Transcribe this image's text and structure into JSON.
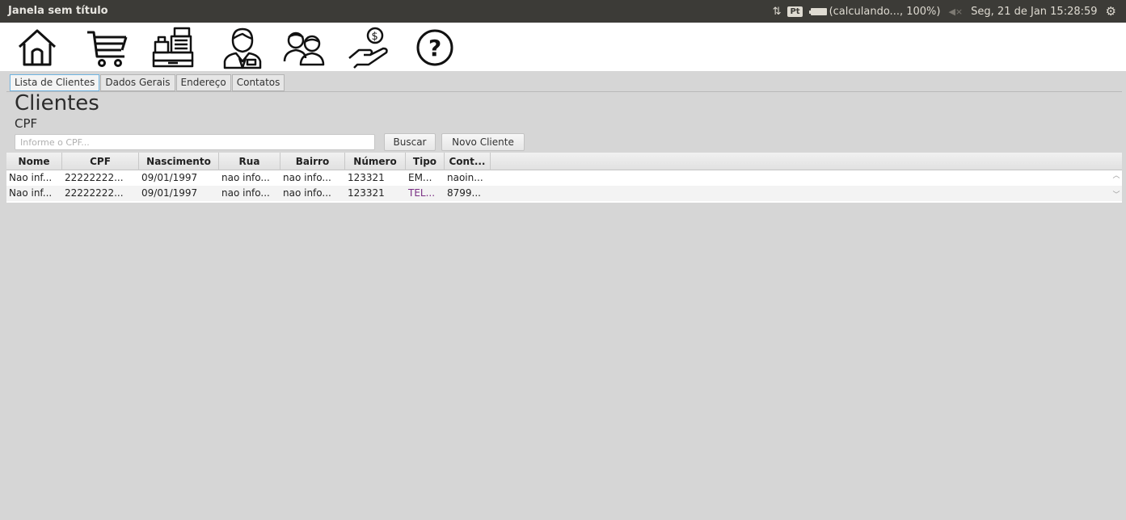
{
  "window": {
    "title": "Janela sem título"
  },
  "system": {
    "lang": "Pt",
    "battery": "(calculando..., 100%)",
    "datetime": "Seg, 21 de Jan 15:28:59"
  },
  "toolbar": {
    "icons": [
      "home-icon",
      "cart-icon",
      "cash-register-icon",
      "user-icon",
      "users-icon",
      "payment-hand-icon",
      "help-icon"
    ]
  },
  "tabs": [
    {
      "label": "Lista de Clientes",
      "active": true
    },
    {
      "label": "Dados Gerais",
      "active": false
    },
    {
      "label": "Endereço",
      "active": false
    },
    {
      "label": "Contatos",
      "active": false
    }
  ],
  "page": {
    "title": "Clientes",
    "cpf_label": "CPF",
    "cpf_placeholder": "Informe o CPF...",
    "buscar_label": "Buscar",
    "novo_label": "Novo Cliente"
  },
  "table": {
    "columns": [
      "Nome",
      "CPF",
      "Nascimento",
      "Rua",
      "Bairro",
      "Número",
      "Tipo",
      "Cont..."
    ],
    "rows": [
      [
        "Nao inf...",
        "22222222...",
        "09/01/1997",
        "nao info...",
        "nao info...",
        "123321",
        "EM...",
        "naoin..."
      ],
      [
        "Nao inf...",
        "22222222...",
        "09/01/1997",
        "nao info...",
        "nao info...",
        "123321",
        "TEL...",
        "8799..."
      ]
    ]
  },
  "colors": {
    "topbar": "#3c3b37",
    "panel": "#d6d6d6",
    "tab_active_border": "#6fb3e0",
    "tipo_tel": "#7a2f84"
  }
}
